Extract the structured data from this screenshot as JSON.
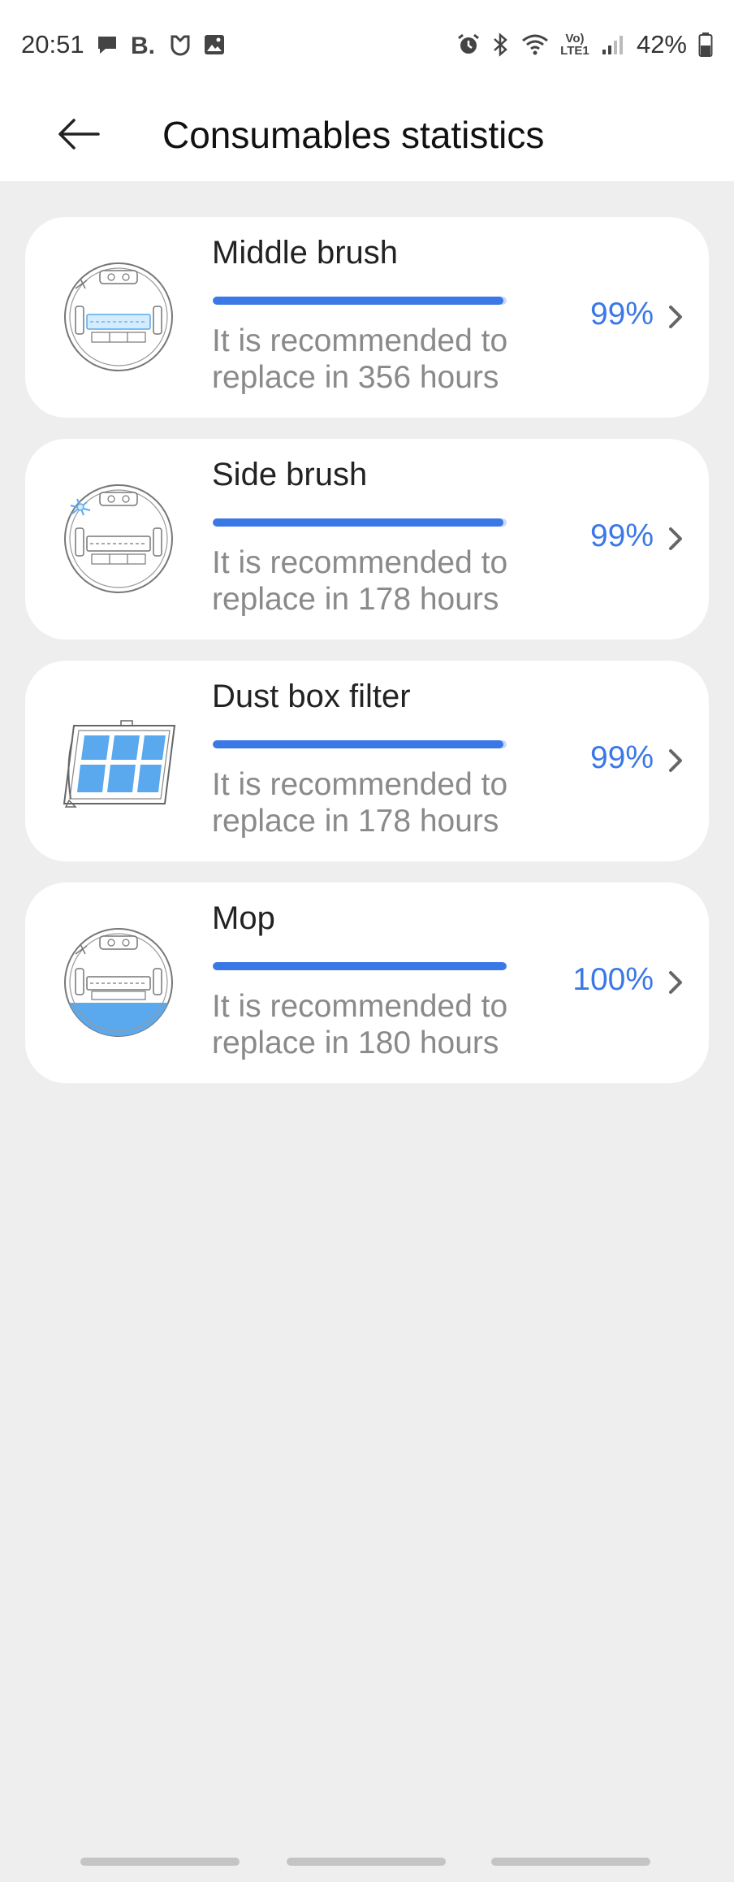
{
  "status_bar": {
    "time": "20:51",
    "network_label": "Vo) LTE1",
    "battery": "42%",
    "left_icons": [
      "chat-bubble-icon",
      "b-app-icon",
      "mi-home-icon",
      "gallery-icon"
    ],
    "right_icons": [
      "alarm-icon",
      "bluetooth-icon",
      "wifi-icon",
      "volte-icon",
      "signal-icon",
      "battery-icon"
    ]
  },
  "header": {
    "title": "Consumables statistics",
    "back_icon": "back-arrow-icon"
  },
  "consumables": [
    {
      "name": "Middle brush",
      "hint_line1": "It is recommended to",
      "hint_line2": "replace in 356 hours",
      "percent_label": "99%",
      "level": 99,
      "icon": "middle-brush-icon"
    },
    {
      "name": "Side brush",
      "hint_line1": "It is recommended to",
      "hint_line2": "replace in 178 hours",
      "percent_label": "99%",
      "level": 99,
      "icon": "side-brush-icon"
    },
    {
      "name": "Dust box filter",
      "hint_line1": "It is recommended to",
      "hint_line2": "replace in 178 hours",
      "percent_label": "99%",
      "level": 99,
      "icon": "dust-box-filter-icon"
    },
    {
      "name": "Mop",
      "hint_line1": "It is recommended to",
      "hint_line2": "replace in 180 hours",
      "percent_label": "100%",
      "level": 100,
      "icon": "mop-icon"
    }
  ],
  "colors": {
    "accent": "#3b78e7",
    "accent_light": "#c9d8f6",
    "background": "#eeeeee",
    "card": "#ffffff",
    "hint_text": "#8a8a8a",
    "icon_fill": "#5aa9ee"
  }
}
